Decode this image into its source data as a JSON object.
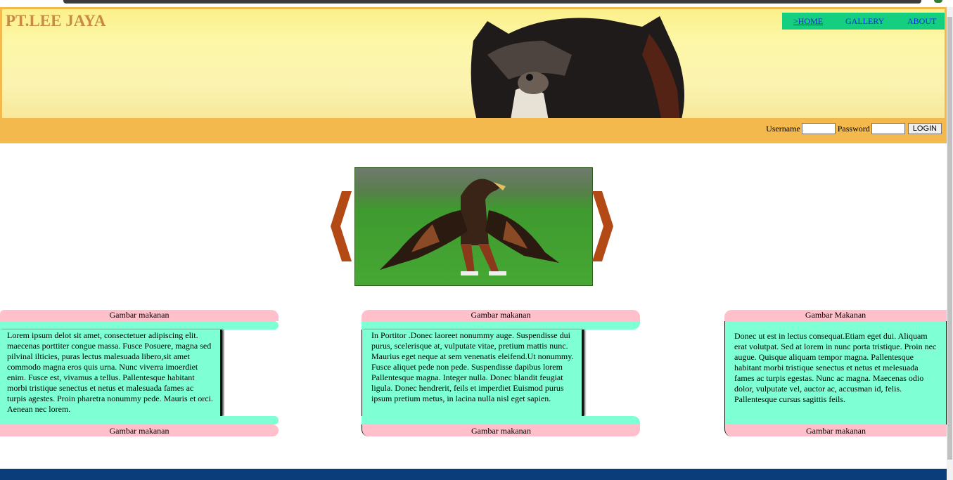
{
  "header": {
    "site_title": "PT.LEE JAYA",
    "nav": [
      {
        "label": ">HOME",
        "active": true
      },
      {
        "label": "GALLERY",
        "active": false
      },
      {
        "label": "ABOUT",
        "active": false
      }
    ],
    "colors": {
      "banner_border": "#f4b94c",
      "nav_bg": "#13cf7f",
      "nav_link": "#1a1aff"
    }
  },
  "login": {
    "username_label": "Username",
    "username_value": "",
    "password_label": "Password",
    "password_value": "",
    "button_label": "LOGIN"
  },
  "slideshow": {
    "prev_icon": "chevron-left-icon",
    "next_icon": "chevron-right-icon",
    "arrow_color": "#b34a16"
  },
  "cards": [
    {
      "caption_top": "Gambar makanan",
      "text": "Lorem ipsum delot sit amet, consectetuer adipiscing elit. maecenas porttiter congue massa. Fusce Posuere, magna sed pilvinal ilticies, puras lectus malesuada libero,sit amet commodo magna eros quis urna. Nunc viverra imoerdiet enim. Fusce est, vivamus a tellus. Pallentesque habitant morbi tristique senectus et netus et malesuada fames ac turpis agestes. Proin pharetra nonummy pede. Mauris et orci. Aenean nec lorem.",
      "caption_bottom": "Gambar makanan"
    },
    {
      "caption_top": "Gambar makanan",
      "text": "In Portitor .Donec laoreet nonummy auge. Suspendisse dui purus, scelerisque at, vulputate vitae, pretium mattis nunc. Maurius eget neque at sem venenatis eleifend.Ut nonummy. Fusce aliquet pede non pede. Suspendisse dapibus lorem Pallentesque magna. Integer nulla. Donec blandit feugiat ligula. Donec hendrerit, feils et imperdiet Euismod purus ipsum pretium metus, in lacina nulla nisl eget sapien.",
      "caption_bottom": "Gambar makanan"
    },
    {
      "caption_top": "Gambar Makanan",
      "text": "Donec ut est in lectus consequat.Etiam eget dui. Aliquam erat volutpat. Sed at lorem in nunc porta tristique. Proin nec augue. Quisque aliquam tempor magna. Pallentesque habitant morbi tristique senectus et netus et melesuada fames ac turpis egestas. Nunc ac magna. Maecenas odio dolor, vulputate vel, auctor ac, accusman id, felis. Pallentesque cursus sagittis feils.",
      "caption_bottom": "Gambar makanan"
    }
  ],
  "card_colors": {
    "caption_bg": "#ffc0cb",
    "body_bg": "#7fffd4"
  },
  "footer": {
    "color": "#0a3d7a"
  }
}
